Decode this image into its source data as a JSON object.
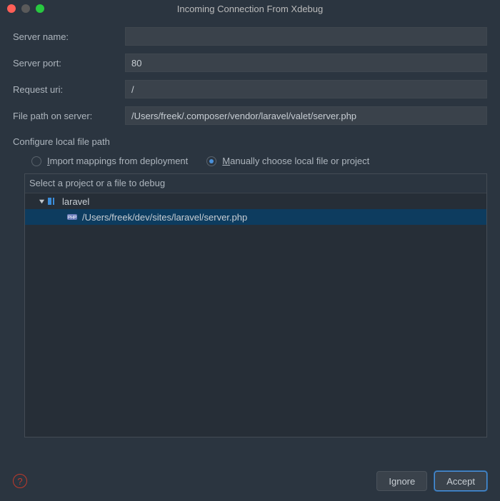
{
  "window": {
    "title": "Incoming Connection From Xdebug"
  },
  "fields": {
    "server_name": {
      "label": "Server name:",
      "value": ""
    },
    "server_port": {
      "label": "Server port:",
      "value": "80"
    },
    "request_uri": {
      "label": "Request uri:",
      "value": "/"
    },
    "file_path": {
      "label": "File path on server:",
      "value": "/Users/freek/.composer/vendor/laravel/valet/server.php"
    }
  },
  "configure_label": "Configure local file path",
  "radios": {
    "import_label_pre": "I",
    "import_label_rest": "mport mappings from deployment",
    "manual_label_pre": "M",
    "manual_label_rest": "anually choose local file or project",
    "selected": "manual"
  },
  "tree": {
    "header": "Select a project or a file to debug",
    "root": {
      "label": "laravel",
      "expanded": true
    },
    "child": {
      "label": "/Users/freek/dev/sites/laravel/server.php"
    }
  },
  "buttons": {
    "help": "?",
    "ignore": "Ignore",
    "accept": "Accept"
  }
}
